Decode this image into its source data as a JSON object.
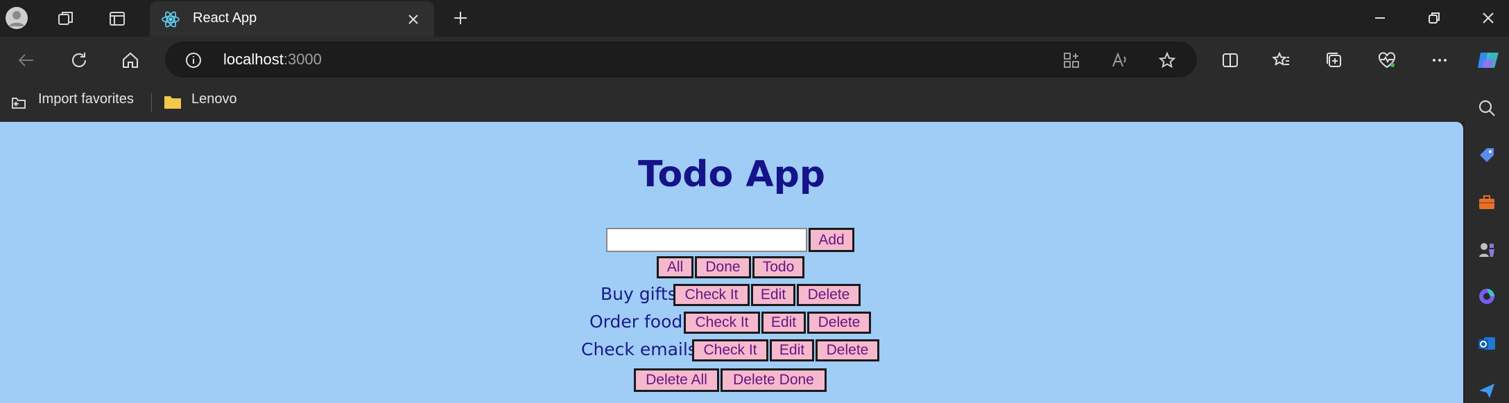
{
  "browser": {
    "tab_title": "React App",
    "url_host": "localhost",
    "url_port": ":3000",
    "favorites": [
      {
        "label": "Import favorites"
      },
      {
        "label": "Lenovo"
      }
    ]
  },
  "app": {
    "title": "Todo App",
    "input_value": "",
    "add_label": "Add",
    "filters": [
      "All",
      "Done",
      "Todo"
    ],
    "todos": [
      {
        "text": "Buy gifts",
        "check": "Check It",
        "edit": "Edit",
        "delete": "Delete"
      },
      {
        "text": "Order food",
        "check": "Check It",
        "edit": "Edit",
        "delete": "Delete"
      },
      {
        "text": "Check emails",
        "check": "Check It",
        "edit": "Edit",
        "delete": "Delete"
      }
    ],
    "delete_all": "Delete All",
    "delete_done": "Delete Done"
  },
  "colors": {
    "page_bg": "#a0cdf5",
    "title": "#15128a",
    "button_bg": "#f5b9cd",
    "button_text": "#6a1480"
  }
}
